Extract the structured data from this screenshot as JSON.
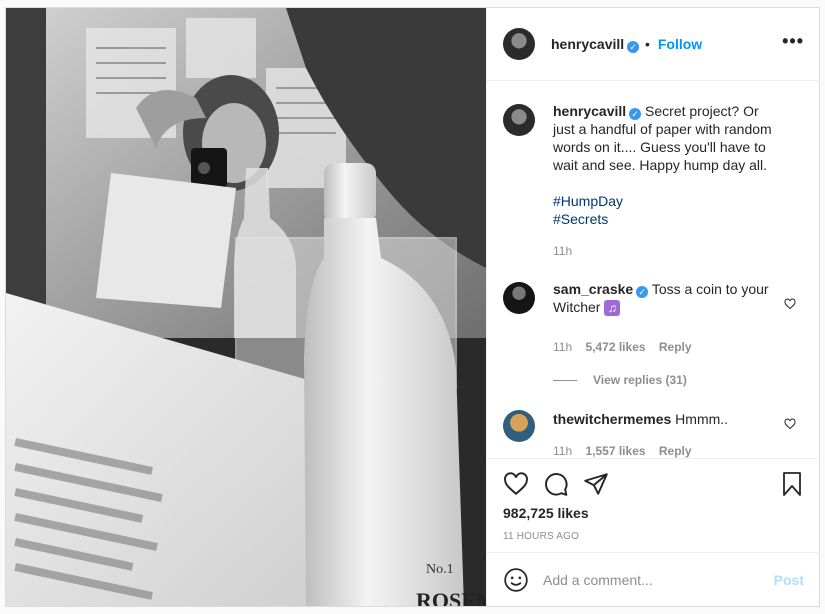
{
  "post": {
    "author": "henrycavill",
    "follow_label": "Follow",
    "separator": "•",
    "more_label": "•••",
    "caption": "Secret project? Or just a handful of paper with random words on it.... Guess you'll have to wait and see. Happy hump day all.",
    "hashtags": [
      "#HumpDay",
      "#Secrets"
    ],
    "caption_time": "11h",
    "comments": [
      {
        "user": "sam_craske",
        "verified": true,
        "text": "Toss a coin to your Witcher",
        "emoji": "♫",
        "time": "11h",
        "likes": "5,472 likes",
        "reply": "Reply",
        "view_replies": "View replies (31)"
      },
      {
        "user": "thewitchermemes",
        "verified": false,
        "text": "Hmmm..",
        "time": "11h",
        "likes": "1,557 likes",
        "reply": "Reply"
      }
    ],
    "likes_total": "982,725 likes",
    "posted_ago": "11 HOURS AGO",
    "add_comment_placeholder": "Add a comment...",
    "post_label": "Post",
    "bottle_text_1": "ROSEMA",
    "bottle_text_2": "No.1"
  },
  "colors": {
    "accent": "#0095f6",
    "verified": "#3897f0",
    "hashtag": "#00376b",
    "muted": "#8e8e8e"
  }
}
